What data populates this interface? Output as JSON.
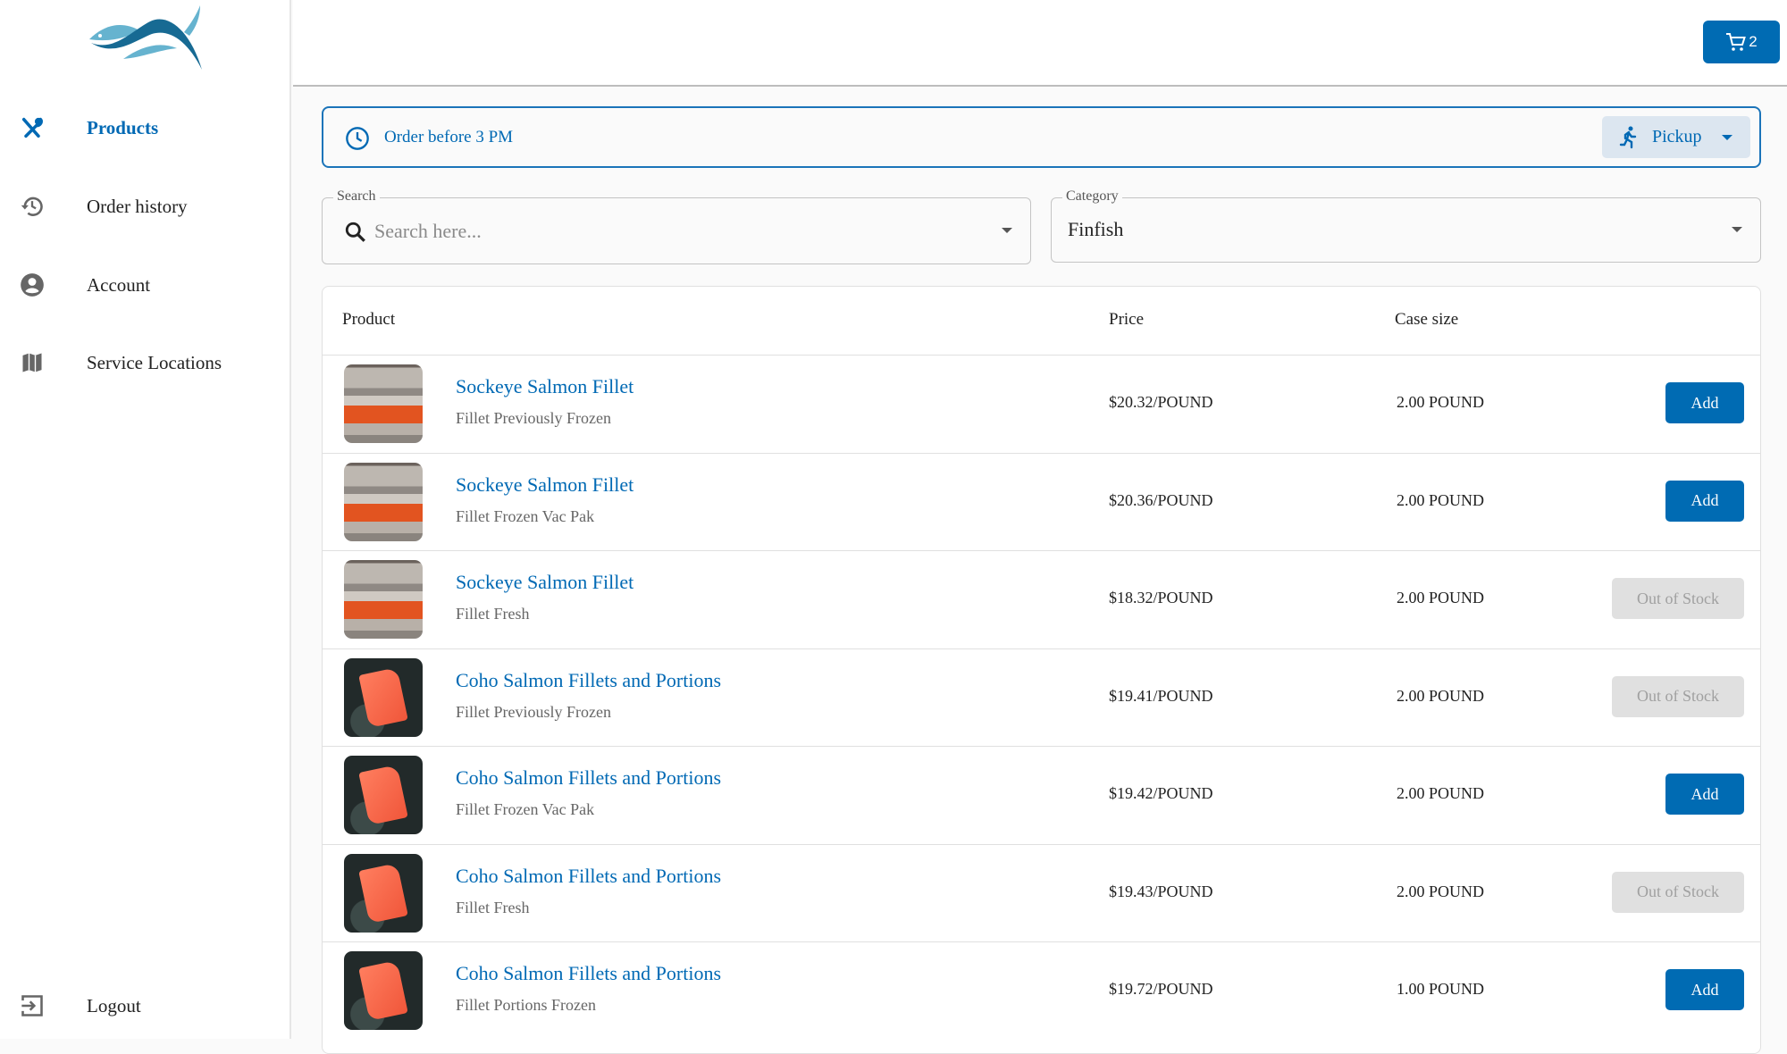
{
  "colors": {
    "accent": "#006bb3",
    "link": "#0069b4",
    "disabled_bg": "#e0e0e0"
  },
  "sidebar": {
    "items": [
      {
        "label": "Products",
        "icon": "utensils-icon",
        "active": true
      },
      {
        "label": "Order history",
        "icon": "history-icon"
      },
      {
        "label": "Account",
        "icon": "account-circle-icon"
      },
      {
        "label": "Service Locations",
        "icon": "map-icon"
      }
    ],
    "logout": {
      "label": "Logout",
      "icon": "logout-icon"
    }
  },
  "header": {
    "cart_count": "2"
  },
  "banner": {
    "text": "Order before 3 PM",
    "fulfillment": "Pickup"
  },
  "filters": {
    "search": {
      "label": "Search",
      "placeholder": "Search here...",
      "value": ""
    },
    "category": {
      "label": "Category",
      "value": "Finfish"
    }
  },
  "table": {
    "columns": [
      "Product",
      "Price",
      "Case size"
    ],
    "rows": [
      {
        "name": "Sockeye Salmon Fillet",
        "variant": "Fillet Previously Frozen",
        "price": "$20.32/POUND",
        "case": "2.00 POUND",
        "action": "Add",
        "in_stock": true,
        "image": "sockeye"
      },
      {
        "name": "Sockeye Salmon Fillet",
        "variant": "Fillet Frozen Vac Pak",
        "price": "$20.36/POUND",
        "case": "2.00 POUND",
        "action": "Add",
        "in_stock": true,
        "image": "sockeye"
      },
      {
        "name": "Sockeye Salmon Fillet",
        "variant": "Fillet Fresh",
        "price": "$18.32/POUND",
        "case": "2.00 POUND",
        "action": "Out of Stock",
        "in_stock": false,
        "image": "sockeye"
      },
      {
        "name": "Coho Salmon Fillets and Portions",
        "variant": "Fillet Previously Frozen",
        "price": "$19.41/POUND",
        "case": "2.00 POUND",
        "action": "Out of Stock",
        "in_stock": false,
        "image": "coho"
      },
      {
        "name": "Coho Salmon Fillets and Portions",
        "variant": "Fillet Frozen Vac Pak",
        "price": "$19.42/POUND",
        "case": "2.00 POUND",
        "action": "Add",
        "in_stock": true,
        "image": "coho"
      },
      {
        "name": "Coho Salmon Fillets and Portions",
        "variant": "Fillet Fresh",
        "price": "$19.43/POUND",
        "case": "2.00 POUND",
        "action": "Out of Stock",
        "in_stock": false,
        "image": "coho"
      },
      {
        "name": "Coho Salmon Fillets and Portions",
        "variant": "Fillet Portions Frozen",
        "price": "$19.72/POUND",
        "case": "1.00 POUND",
        "action": "Add",
        "in_stock": true,
        "image": "coho"
      }
    ]
  }
}
